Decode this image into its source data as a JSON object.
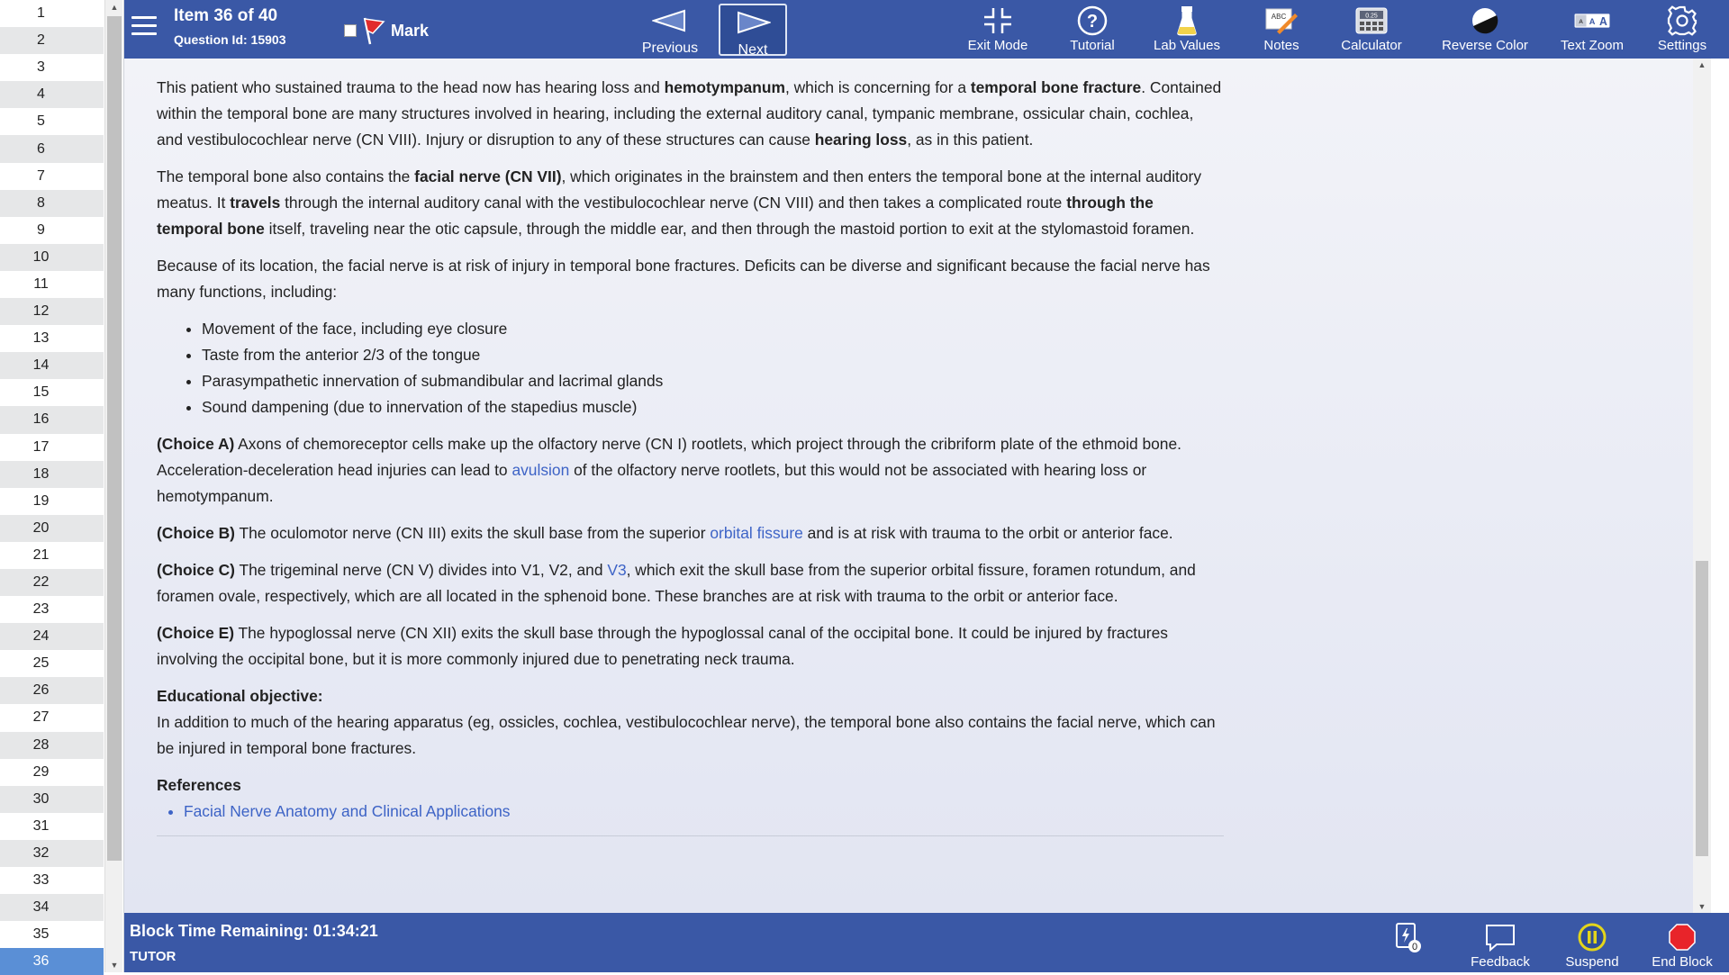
{
  "question_list": {
    "items": [
      "1",
      "2",
      "3",
      "4",
      "5",
      "6",
      "7",
      "8",
      "9",
      "10",
      "11",
      "12",
      "13",
      "14",
      "15",
      "16",
      "17",
      "18",
      "19",
      "20",
      "21",
      "22",
      "23",
      "24",
      "25",
      "26",
      "27",
      "28",
      "29",
      "30",
      "31",
      "32",
      "33",
      "34",
      "35",
      "36"
    ],
    "active_index": 35
  },
  "toolbar": {
    "item_label": "Item 36 of 40",
    "question_id": "Question Id: 15903",
    "mark_label": "Mark",
    "previous_label": "Previous",
    "next_label": "Next",
    "exit_mode_label": "Exit Mode",
    "tutorial_label": "Tutorial",
    "lab_values_label": "Lab Values",
    "notes_label": "Notes",
    "calculator_label": "Calculator",
    "calculator_display": "0.25",
    "notes_icon_text": "ABC",
    "reverse_color_label": "Reverse Color",
    "text_zoom_label": "Text Zoom",
    "text_zoom_letters": [
      "A",
      "A",
      "A"
    ],
    "settings_label": "Settings"
  },
  "explanation": {
    "p1": [
      {
        "t": "This patient who sustained trauma to the head now has hearing loss and ",
        "s": "n"
      },
      {
        "t": "hemotympanum",
        "s": "b"
      },
      {
        "t": ", which is concerning for a ",
        "s": "n"
      },
      {
        "t": "temporal bone fracture",
        "s": "b"
      },
      {
        "t": ".  Contained within the temporal bone are many structures involved in hearing, including the external auditory canal, tympanic membrane, ossicular chain, cochlea, and vestibulocochlear nerve (CN VIII).  Injury or disruption to any of these structures can cause ",
        "s": "n"
      },
      {
        "t": "hearing loss",
        "s": "b"
      },
      {
        "t": ", as in this patient.",
        "s": "n"
      }
    ],
    "p2": [
      {
        "t": "The temporal bone also contains the ",
        "s": "n"
      },
      {
        "t": "facial nerve (CN VII)",
        "s": "b"
      },
      {
        "t": ", which originates in the brainstem and then enters the temporal bone at the internal auditory meatus.  It ",
        "s": "n"
      },
      {
        "t": "travels",
        "s": "b"
      },
      {
        "t": " through the internal auditory canal with the vestibulocochlear nerve (CN VIII) and then takes a complicated route ",
        "s": "n"
      },
      {
        "t": "through the temporal bone",
        "s": "b"
      },
      {
        "t": " itself, traveling near the otic capsule, through the middle ear, and then through the mastoid portion to exit at the stylomastoid foramen.",
        "s": "n"
      }
    ],
    "p3": "Because of its location, the facial nerve is at risk of injury in temporal bone fractures.  Deficits can be diverse and significant because the facial nerve has many functions, including:",
    "functions": [
      "Movement of the face, including eye closure",
      "Taste from the anterior 2/3 of the tongue",
      "Parasympathetic innervation of submandibular and lacrimal glands",
      "Sound dampening (due to innervation of the stapedius muscle)"
    ],
    "choice_a": [
      {
        "t": "(Choice A)",
        "s": "b"
      },
      {
        "t": "  Axons of chemoreceptor cells make up the olfactory nerve (CN I) rootlets, which project through the cribriform plate of the ethmoid bone.  Acceleration-deceleration head injuries can lead to ",
        "s": "n"
      },
      {
        "t": "avulsion",
        "s": "l"
      },
      {
        "t": " of the olfactory nerve rootlets, but this would not be associated with hearing loss or hemotympanum.",
        "s": "n"
      }
    ],
    "choice_b": [
      {
        "t": "(Choice B)",
        "s": "b"
      },
      {
        "t": "  The oculomotor nerve (CN III) exits the skull base from the superior ",
        "s": "n"
      },
      {
        "t": "orbital fissure",
        "s": "l"
      },
      {
        "t": " and is at risk with trauma to the orbit or anterior face.",
        "s": "n"
      }
    ],
    "choice_c": [
      {
        "t": "(Choice C)",
        "s": "b"
      },
      {
        "t": "  The trigeminal nerve (CN V) divides into V1, V2, and ",
        "s": "n"
      },
      {
        "t": "V3",
        "s": "l"
      },
      {
        "t": ", which exit the skull base from the superior orbital fissure, foramen rotundum, and foramen ovale, respectively, which are all located in the sphenoid bone.  These branches are at risk with trauma to the orbit or anterior face.",
        "s": "n"
      }
    ],
    "choice_e": [
      {
        "t": "(Choice E)",
        "s": "b"
      },
      {
        "t": "  The hypoglossal nerve (CN XII) exits the skull base through the hypoglossal canal of the occipital bone.  It could be injured by fractures involving the occipital bone, but it is more commonly injured due to penetrating neck trauma.",
        "s": "n"
      }
    ],
    "objective_heading": "Educational objective:",
    "objective_text": "In addition to much of the hearing apparatus (eg, ossicles, cochlea, vestibulocochlear nerve), the temporal bone also contains the facial nerve, which can be injured in temporal bone fractures.",
    "references_heading": "References",
    "references": [
      "Facial Nerve Anatomy and Clinical Applications"
    ]
  },
  "bottombar": {
    "time_remaining": "Block Time Remaining: 01:34:21",
    "mode": "TUTOR",
    "flash_count": "0",
    "feedback_label": "Feedback",
    "suspend_label": "Suspend",
    "end_block_label": "End Block"
  },
  "colors": {
    "bar": "#3a58a6",
    "link": "#3d63c6",
    "active_row": "#5a8fd6",
    "end_block": "#e8242a",
    "suspend": "#e3d51b"
  }
}
